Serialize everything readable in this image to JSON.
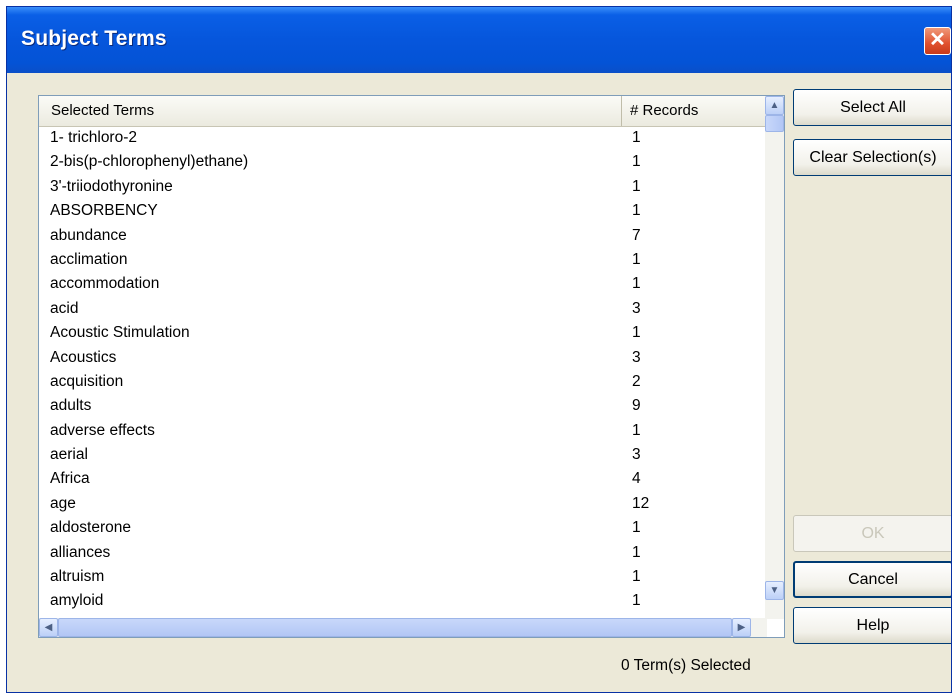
{
  "window": {
    "title": "Subject Terms",
    "close_glyph": "✕"
  },
  "list": {
    "columns": [
      "Selected Terms",
      "# Records"
    ],
    "rows": [
      {
        "term": "1- trichloro-2",
        "records": "1"
      },
      {
        "term": "2-bis(p-chlorophenyl)ethane)",
        "records": "1"
      },
      {
        "term": "3'-triiodothyronine",
        "records": "1"
      },
      {
        "term": "ABSORBENCY",
        "records": "1"
      },
      {
        "term": "abundance",
        "records": "7"
      },
      {
        "term": "acclimation",
        "records": "1"
      },
      {
        "term": "accommodation",
        "records": "1"
      },
      {
        "term": "acid",
        "records": "3"
      },
      {
        "term": "Acoustic Stimulation",
        "records": "1"
      },
      {
        "term": "Acoustics",
        "records": "3"
      },
      {
        "term": "acquisition",
        "records": "2"
      },
      {
        "term": "adults",
        "records": "9"
      },
      {
        "term": "adverse effects",
        "records": "1"
      },
      {
        "term": "aerial",
        "records": "3"
      },
      {
        "term": "Africa",
        "records": "4"
      },
      {
        "term": "age",
        "records": "12"
      },
      {
        "term": "aldosterone",
        "records": "1"
      },
      {
        "term": "alliances",
        "records": "1"
      },
      {
        "term": "altruism",
        "records": "1"
      },
      {
        "term": "amyloid",
        "records": "1"
      }
    ]
  },
  "buttons": {
    "select_all": "Select All",
    "clear_selection": "Clear Selection(s)",
    "ok": "OK",
    "cancel": "Cancel",
    "help": "Help"
  },
  "status": "0 Term(s) Selected",
  "scroll_icons": {
    "up": "▲",
    "down": "▼",
    "left": "◀",
    "right": "▶"
  }
}
